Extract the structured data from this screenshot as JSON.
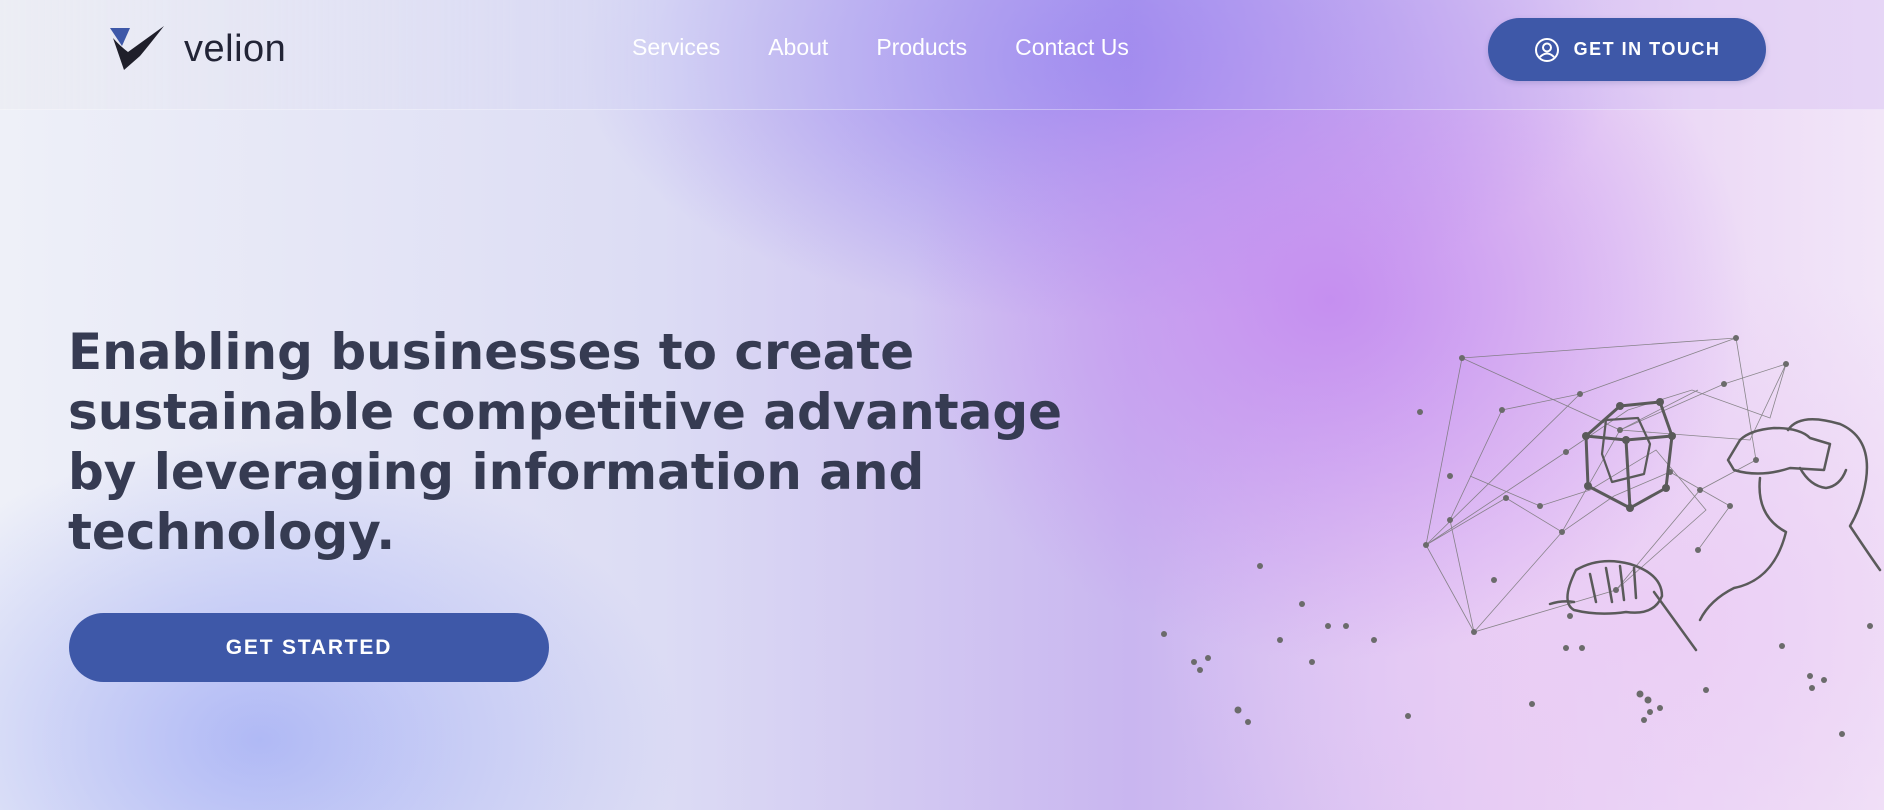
{
  "header": {
    "brand": "velion",
    "nav": [
      {
        "label": "Services"
      },
      {
        "label": "About"
      },
      {
        "label": "Products"
      },
      {
        "label": "Contact Us"
      }
    ],
    "cta_label": "GET IN TOUCH",
    "cta_icon": "user-circle-icon"
  },
  "hero": {
    "title": "Enabling businesses to create sustainable competitive advantage by leveraging information and technology.",
    "cta_label": "GET STARTED"
  },
  "colors": {
    "primary_button": "#3e58a8",
    "heading": "#363b52",
    "logo_accent": "#3e58a8",
    "logo_dark": "#1f1f2a"
  }
}
